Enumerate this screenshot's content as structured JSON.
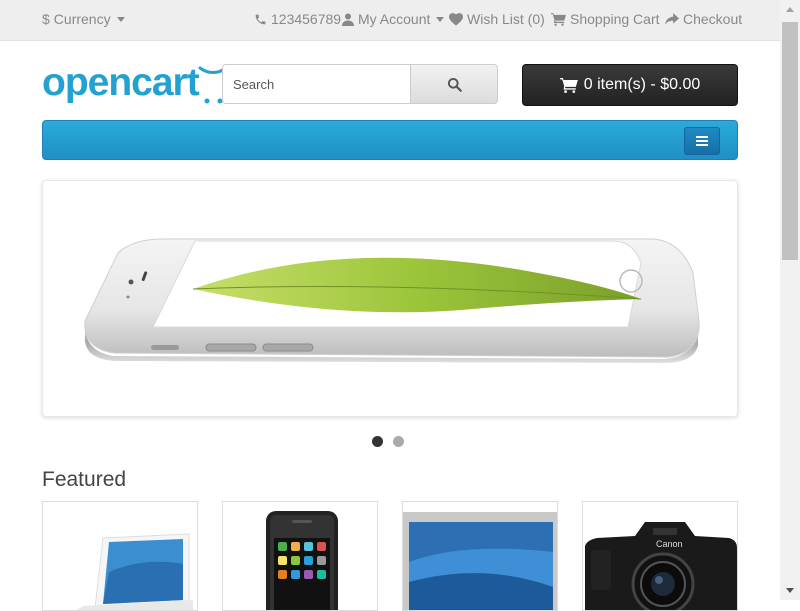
{
  "topbar": {
    "currency_label": "Currency",
    "currency_symbol": "$",
    "phone": "123456789",
    "my_account": "My Account",
    "wishlist": "Wish List (0)",
    "shopping_cart": "Shopping Cart",
    "checkout": "Checkout"
  },
  "header": {
    "logo_text": "opencart",
    "search_placeholder": "Search",
    "search_value": "",
    "cart_label": "0 item(s) - $0.00"
  },
  "colors": {
    "brand": "#23a1d1",
    "nav": "#229ed6",
    "cart_button": "#2c2c2c"
  },
  "slideshow": {
    "slide_count": 2,
    "active_slide": 1
  },
  "featured": {
    "title": "Featured",
    "products": [
      {
        "image": "laptop-white"
      },
      {
        "image": "smartphone"
      },
      {
        "image": "laptop-silver"
      },
      {
        "image": "dslr-camera"
      }
    ]
  }
}
